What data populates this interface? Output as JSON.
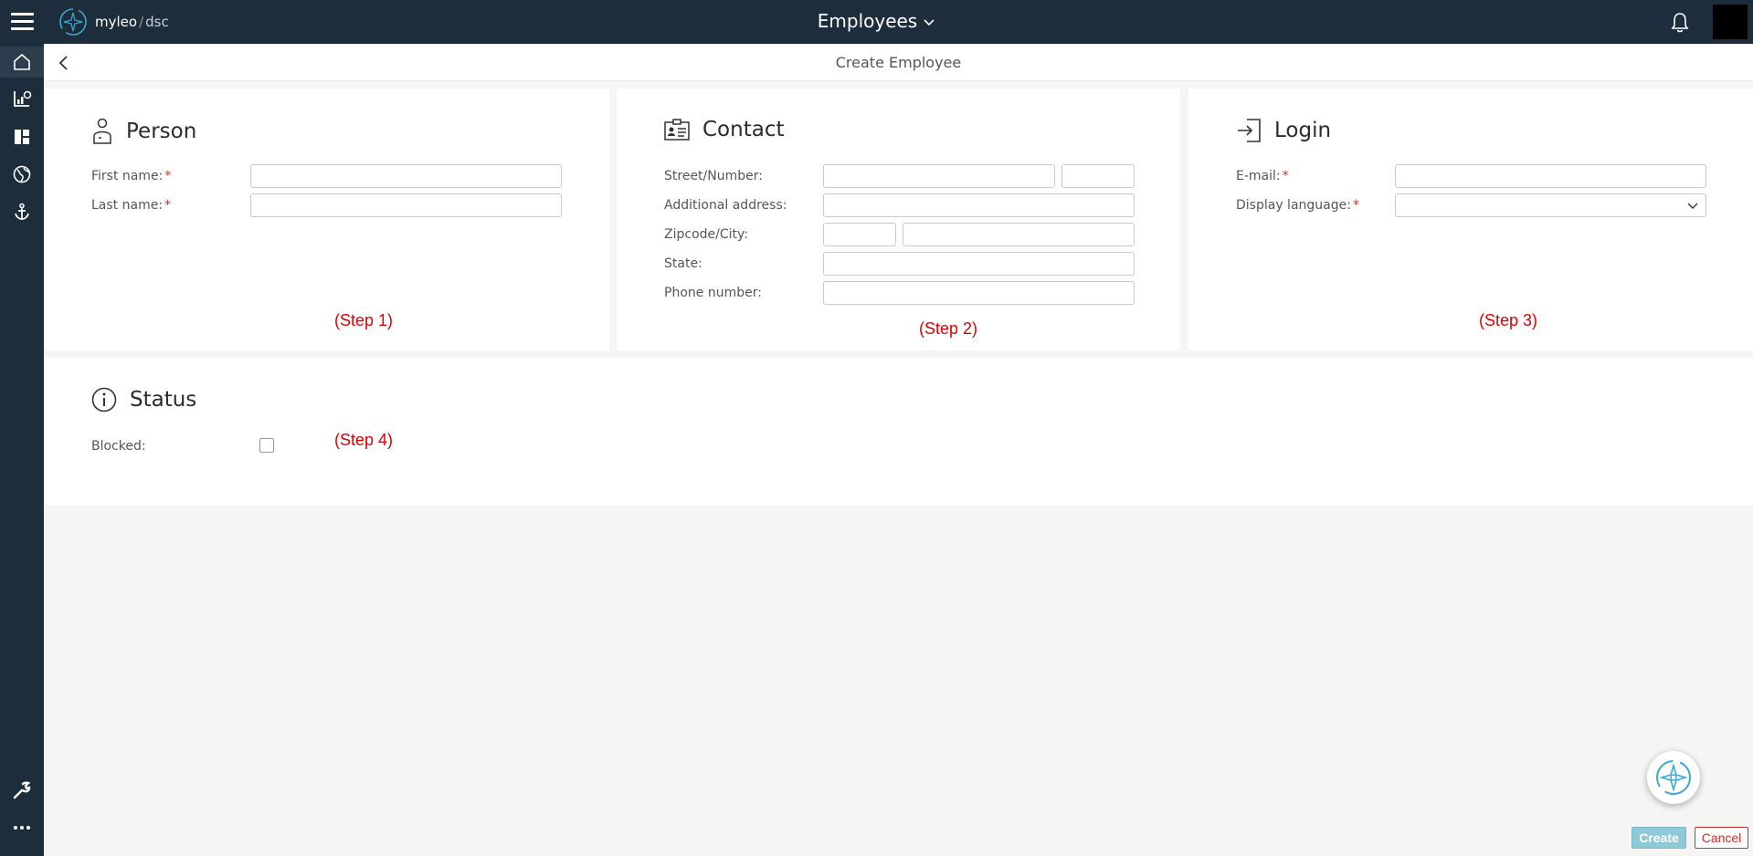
{
  "app": {
    "brand": "myleo",
    "separator": "/",
    "product": "dsc",
    "title": "Employees"
  },
  "sidebar": {
    "items": [
      {
        "icon": "home-icon"
      },
      {
        "icon": "chart-icon"
      },
      {
        "icon": "dashboard-icon"
      },
      {
        "icon": "globe-icon"
      },
      {
        "icon": "anchor-icon"
      },
      {
        "icon": "wrench-icon"
      },
      {
        "icon": "more-icon"
      }
    ]
  },
  "page": {
    "title": "Create Employee"
  },
  "person": {
    "title": "Person",
    "first_name_label": "First name:",
    "last_name_label": "Last name:",
    "required_mark": "*",
    "step": "(Step 1)"
  },
  "contact": {
    "title": "Contact",
    "street_label": "Street/Number:",
    "additional_label": "Additional address:",
    "zip_label": "Zipcode/City:",
    "state_label": "State:",
    "phone_label": "Phone number:",
    "step": "(Step 2)"
  },
  "login": {
    "title": "Login",
    "email_label": "E-mail:",
    "language_label": "Display language:",
    "required_mark": "*",
    "language_value": "",
    "step": "(Step 3)"
  },
  "status": {
    "title": "Status",
    "blocked_label": "Blocked:",
    "blocked_checked": false,
    "step": "(Step 4)"
  },
  "actions": {
    "create": "Create",
    "cancel": "Cancel"
  },
  "colors": {
    "nav_bg": "#1e2d3b",
    "accent": "#8dc9d6",
    "danger": "#d32f2f",
    "step_red": "#e00000"
  }
}
